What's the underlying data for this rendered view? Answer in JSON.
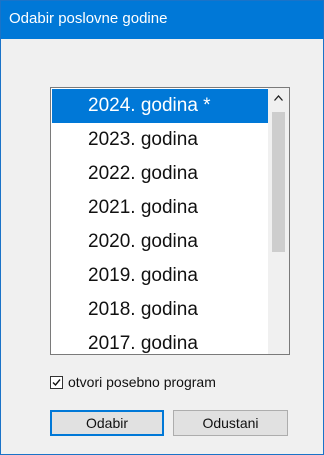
{
  "window": {
    "title": "Odabir poslovne godine"
  },
  "colors": {
    "accent": "#0078d7",
    "window_bg": "#f0f0f0",
    "list_bg": "#ffffff"
  },
  "year_list": {
    "selected_index": 0,
    "items": [
      {
        "label": "2024. godina *"
      },
      {
        "label": "2023. godina"
      },
      {
        "label": "2022. godina"
      },
      {
        "label": "2021. godina"
      },
      {
        "label": "2020. godina"
      },
      {
        "label": "2019. godina"
      },
      {
        "label": "2018. godina"
      },
      {
        "label": "2017. godina"
      }
    ],
    "scroll_up_icon": "chevron-up-icon"
  },
  "options": {
    "open_separately_label": "otvori posebno program",
    "open_separately_checked": true
  },
  "buttons": {
    "ok_label": "Odabir",
    "cancel_label": "Odustani"
  }
}
